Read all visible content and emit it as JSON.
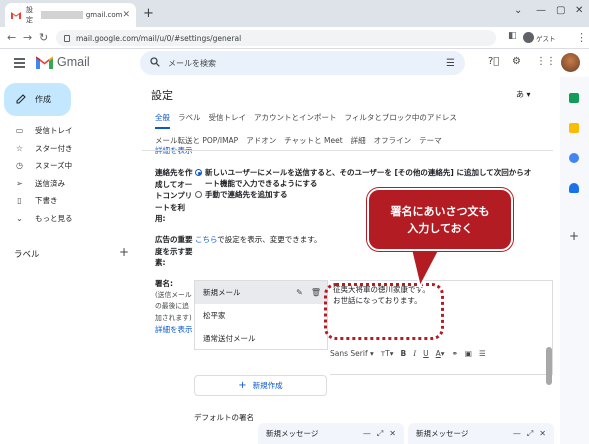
{
  "browser": {
    "tab_title_prefix": "設定",
    "tab_title_suffix": "gmail.com",
    "new_tab": "+",
    "url": "mail.google.com/mail/u/0/#settings/general",
    "profile_label": "ゲスト"
  },
  "header": {
    "app_name": "Gmail",
    "search_placeholder": "メールを検索"
  },
  "sidebar": {
    "compose_label": "作成",
    "items": [
      {
        "label": "受信トレイ",
        "icon": "inbox-icon",
        "glyph": "▭"
      },
      {
        "label": "スター付き",
        "icon": "star-icon",
        "glyph": "☆"
      },
      {
        "label": "スヌーズ中",
        "icon": "clock-icon",
        "glyph": "◷"
      },
      {
        "label": "送信済み",
        "icon": "send-icon",
        "glyph": "➢"
      },
      {
        "label": "下書き",
        "icon": "draft-icon",
        "glyph": "▯"
      },
      {
        "label": "もっと見る",
        "icon": "chevron-down-icon",
        "glyph": "⌄"
      }
    ],
    "labels_heading": "ラベル",
    "labels_add": "+"
  },
  "settings": {
    "title": "設定",
    "language_indicator": "あ",
    "tabs_row1": [
      "全般",
      "ラベル",
      "受信トレイ",
      "アカウントとインポート",
      "フィルタとブロック中のアドレス"
    ],
    "tabs_row2": [
      "メール転送と POP/IMAP",
      "アドオン",
      "チャットと Meet",
      "詳細",
      "オフライン",
      "テーマ"
    ],
    "cut_link": "詳細を表示",
    "contacts": {
      "label_lines": [
        "連絡先を作",
        "成してオー",
        "トコンプリ",
        "ートを利",
        "用:"
      ],
      "option1_lines": [
        "新しいユーザーにメールを送信すると、そのユーザーを [その他の連絡先] に追加して次回からオ",
        "ート機能で入力できるようにする"
      ],
      "option2": "手動で連絡先を追加する"
    },
    "importance": {
      "label_lines": [
        "広告の重要",
        "度を示す要",
        "素:"
      ],
      "link": "こちら",
      "text": "で設定を表示、変更できます。"
    },
    "signature": {
      "label": "署名:",
      "desc_lines": [
        "(送信メール",
        "の最後に追",
        "加されます)"
      ],
      "more_link": "詳細を表示",
      "items": [
        "新規メール",
        "松平家",
        "通常送付メール"
      ],
      "body_lines": [
        "征夷大将軍の徳川家康です。",
        "お世話になっております。"
      ],
      "font_name": "Sans Serif",
      "new_button": "新規作成",
      "default_heading": "デフォルトの署名"
    }
  },
  "callout": {
    "lines": [
      "署名にあいさつ文も",
      "入力しておく"
    ],
    "color": "#b41c23"
  },
  "compose_windows": [
    "新規メッセージ",
    "新規メッセージ"
  ],
  "colors": {
    "accent": "#0b57d0",
    "compose_bg": "#c2e7ff",
    "search_bg": "#eaf1fb"
  }
}
